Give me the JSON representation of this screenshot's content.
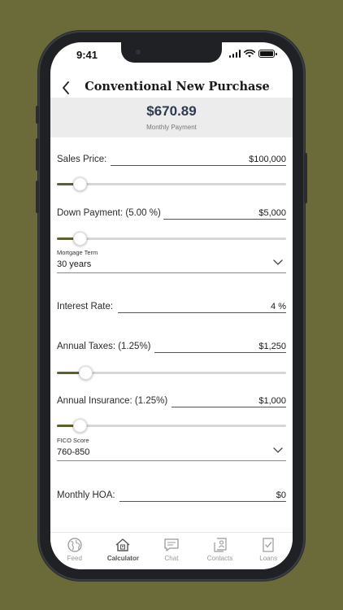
{
  "status": {
    "time": "9:41"
  },
  "header": {
    "title": "Conventional New Purchase"
  },
  "payment": {
    "amount": "$670.89",
    "label": "Monthly Payment"
  },
  "fields": {
    "sales_price": {
      "label": "Sales Price:",
      "value": "$100,000",
      "slider_fraction": 0.1
    },
    "down_payment": {
      "label": "Down Payment:  (5.00 %)",
      "value": "$5,000",
      "slider_fraction": 0.1
    },
    "mortgage_term": {
      "label": "Mortgage Term",
      "value": "30 years"
    },
    "interest_rate": {
      "label": "Interest Rate:",
      "value": "4 %"
    },
    "annual_taxes": {
      "label": "Annual Taxes:  (1.25%)",
      "value": "$1,250",
      "slider_fraction": 0.125
    },
    "annual_insurance": {
      "label": "Annual Insurance:  (1.25%)",
      "value": "$1,000",
      "slider_fraction": 0.1
    },
    "fico_score": {
      "label": "FICO Score",
      "value": "760-850"
    },
    "monthly_hoa": {
      "label": "Monthly HOA:",
      "value": "$0"
    }
  },
  "tabs": [
    {
      "label": "Feed",
      "icon": "globe-icon"
    },
    {
      "label": "Calculator",
      "icon": "house-calculator-icon",
      "active": true
    },
    {
      "label": "Chat",
      "icon": "chat-icon"
    },
    {
      "label": "Contacts",
      "icon": "contacts-icon"
    },
    {
      "label": "Loans",
      "icon": "document-check-icon"
    }
  ],
  "colors": {
    "background": "#6b6b3a",
    "slider_fill": "#5f5f2e",
    "payment_text": "#2e3b4e"
  }
}
